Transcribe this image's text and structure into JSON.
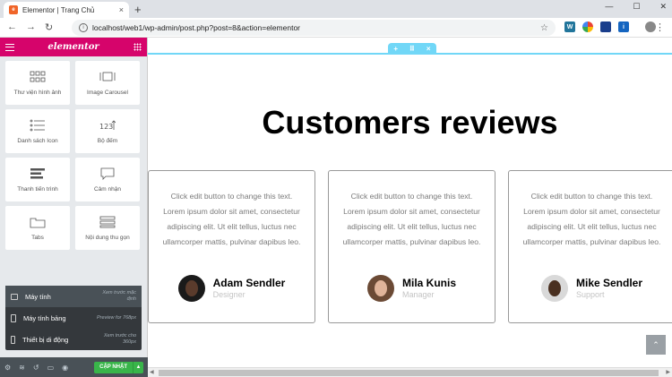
{
  "browser": {
    "tab_title": "Elementor | Trang Chủ",
    "url": "localhost/web1/wp-admin/post.php?post=8&action=elementor"
  },
  "panel": {
    "brand": "elementor",
    "widgets": [
      {
        "label": "Thư viện hình ảnh",
        "icon": "gallery-icon"
      },
      {
        "label": "Image Carousel",
        "icon": "carousel-icon"
      },
      {
        "label": "Danh sách Icon",
        "icon": "icon-list-icon"
      },
      {
        "label": "Bộ đếm",
        "icon": "counter-icon"
      },
      {
        "label": "Thanh tiến trình",
        "icon": "progress-icon"
      },
      {
        "label": "Cảm nhận",
        "icon": "testimonial-icon"
      },
      {
        "label": "Tabs",
        "icon": "tabs-icon"
      },
      {
        "label": "Nội dung thu gọn",
        "icon": "accordion-icon"
      }
    ],
    "responsive": [
      {
        "label": "Máy tính",
        "hint": "Xem trước mặc định"
      },
      {
        "label": "Máy tính bảng",
        "hint": "Preview for 768px"
      },
      {
        "label": "Thiết bị di động",
        "hint": "Xem trước cho 360px"
      }
    ],
    "update_label": "CẬP NHẬT",
    "counter_glyph": "123"
  },
  "canvas": {
    "heading": "Customers reviews",
    "reviews": [
      {
        "text": "Click edit button to change this text. Lorem ipsum dolor sit amet, consectetur adipiscing elit. Ut elit tellus, luctus nec ullamcorper mattis, pulvinar dapibus leo.",
        "name": "Adam Sendler",
        "role": "Designer"
      },
      {
        "text": "Click edit button to change this text. Lorem ipsum dolor sit amet, consectetur adipiscing elit. Ut elit tellus, luctus nec ullamcorper mattis, pulvinar dapibus leo.",
        "name": "Mila Kunis",
        "role": "Manager"
      },
      {
        "text": "Click edit button to change this text. Lorem ipsum dolor sit amet, consectetur adipiscing elit. Ut elit tellus, luctus nec ullamcorper mattis, pulvinar dapibus leo.",
        "name": "Mike Sendler",
        "role": "Support"
      }
    ]
  },
  "colors": {
    "brand": "#d6046b",
    "section_handle": "#71d7f7",
    "update_button": "#39b54a"
  }
}
